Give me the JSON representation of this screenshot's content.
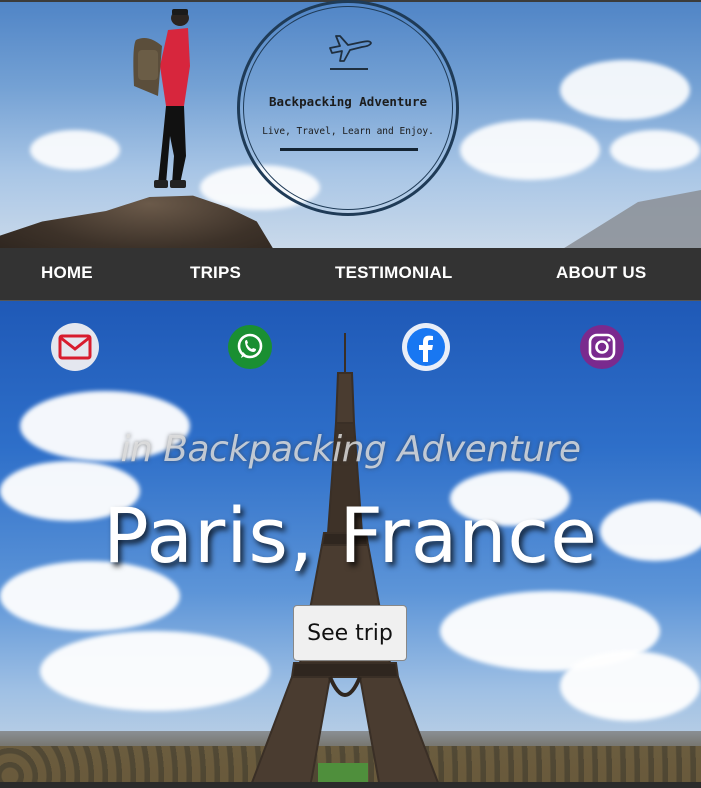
{
  "logo": {
    "title": "Backpacking Adventure",
    "tagline": "Live, Travel, Learn and Enjoy.",
    "icon": "airplane-icon"
  },
  "nav": {
    "items": [
      {
        "label": "HOME"
      },
      {
        "label": "TRIPS"
      },
      {
        "label": "TESTIMONIAL"
      },
      {
        "label": "ABOUT US"
      }
    ]
  },
  "social": [
    {
      "icon": "mail-icon",
      "color": "#d81c2e"
    },
    {
      "icon": "whatsapp-icon",
      "color": "#1a8f32"
    },
    {
      "icon": "facebook-icon",
      "color": "#1877f2"
    },
    {
      "icon": "instagram-icon",
      "color": "#7a2a8e"
    }
  ],
  "hero": {
    "subtitle": "in Backpacking Adventure",
    "headline": "Paris, France",
    "cta_label": "See trip"
  },
  "colors": {
    "nav_bg": "#333333",
    "logo_ink": "#1f3b57"
  }
}
